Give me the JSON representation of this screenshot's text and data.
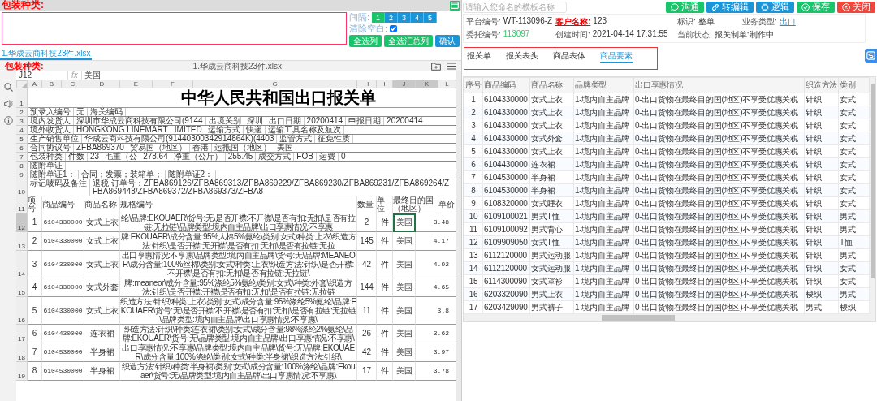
{
  "left": {
    "header_label": "包装种类:",
    "interval_label": "间隔:",
    "interval_buttons": [
      {
        "label": "1",
        "selected": true
      },
      {
        "label": "2",
        "selected": false
      },
      {
        "label": "3",
        "selected": false
      },
      {
        "label": "4",
        "selected": false
      },
      {
        "label": "5",
        "selected": false
      }
    ],
    "clear_blank": {
      "label": "清除空白:",
      "checked": true
    },
    "actions": [
      {
        "label": "全选列",
        "color": "#19c46b"
      },
      {
        "label": "全选汇总列",
        "color": "#19c46b"
      },
      {
        "label": "确认",
        "color": "#1b95d8"
      }
    ],
    "file_tabs": [
      {
        "label": "1.华成云商科技23件.xlsx",
        "selected": true
      }
    ],
    "sheet": {
      "panel_label": "包装种类:",
      "file_name": "1.华成云商科技23件.xlsx",
      "cell_ref": "J12",
      "fx_label": "fx",
      "formula": "美国",
      "columns": [
        {
          "label": "A",
          "selected": false
        },
        {
          "label": "B",
          "selected": false
        },
        {
          "label": "C",
          "selected": false
        },
        {
          "label": "D",
          "selected": false
        },
        {
          "label": "E",
          "selected": false
        },
        {
          "label": "F",
          "selected": false
        },
        {
          "label": "G",
          "selected": false
        },
        {
          "label": "H",
          "selected": false
        },
        {
          "label": "I",
          "selected": false
        },
        {
          "label": "J",
          "selected": true
        },
        {
          "label": "K",
          "selected": true
        },
        {
          "label": "L",
          "selected": false
        }
      ],
      "title_row": "1",
      "title": "中华人民共和国出口报关单",
      "header_rows": [
        {
          "row": "2",
          "cells": [
            "预录入编号",
            "无",
            "海关编码"
          ]
        },
        {
          "row": "3",
          "cells": [
            "境内发货人",
            "深圳市华成云商科技有限公司(9144",
            "出境关别",
            "深圳",
            "出口日期",
            "20200414",
            "申报日期",
            "20200414"
          ]
        },
        {
          "row": "4",
          "cells": [
            "境外收货人",
            "HONGKONG LINEMART LIMITED",
            "运输方式",
            "快递",
            "运输工具名称及航次"
          ]
        },
        {
          "row": "5",
          "cells": [
            "生产销售单位",
            "华成云商科技有限公司(91440300342914864K)(4403",
            "监管方式",
            "征免性质"
          ]
        },
        {
          "row": "6",
          "cells": [
            "合同协议号",
            "ZFBA869370",
            "贸易国（地区）",
            "香港",
            "运抵国（地区）",
            "美国"
          ]
        },
        {
          "row": "7",
          "cells": [
            "包装种类",
            "件数",
            "23",
            "毛重（公",
            "278.64",
            "净重（公斤）",
            "255.45",
            "成交方式",
            "FOB",
            "运费",
            "0"
          ]
        },
        {
          "row": "8",
          "cells": [
            "随附单证"
          ]
        },
        {
          "row": "9",
          "cells": [
            "随附单证1：",
            "合同；发票；装箱单；",
            "随附单证2："
          ]
        },
        {
          "row": "10",
          "cells": [
            "标记唛码及备注",
            "退税 订单号：ZFBA869126/ZFBA869313/ZFBA869229/ZFBA869230/ZFBA869231/ZFBA869264/ZFBA869448/ZFBA869372/ZFBA869373/ZFBA8"
          ]
        }
      ],
      "item_header": {
        "row": "11",
        "no": "项号",
        "code": "商品编号",
        "name": "商品名称",
        "spec": "规格编号",
        "qty": "数量",
        "unit": "单位",
        "country": "最终目的国（地区）",
        "price": "单价"
      },
      "items": [
        {
          "row": "12",
          "no": "1",
          "code": "6104330000",
          "name": "女式上衣",
          "spec": "纶\\品牌:EKOUAER\\货号:无\\是否开襟:不开襟\\是否有扣:无扣\\是否有拉链:无拉链\\品牌类型:境内自主品牌\\出口享惠情况:不享惠",
          "qty": "2",
          "unit": "件",
          "country": "美国",
          "price": "3.48",
          "selected": true
        },
        {
          "row": "13",
          "no": "2",
          "code": "6104330000",
          "name": "女式上衣",
          "spec": "牌:EKOUAER\\成分含量:95%人棉5%氨纶\\类别:女式\\种类:上衣\\织造方法:针织\\是否开襟:无开襟\\是否有扣:无扣\\是否有拉链:无拉",
          "qty": "145",
          "unit": "件",
          "country": "美国",
          "price": "4.17",
          "selected": false
        },
        {
          "row": "14",
          "no": "3",
          "code": "6104330000",
          "name": "女式上衣",
          "spec": "出口享惠情况:不享惠\\品牌类型:境内自主品牌\\货号:无\\品牌:MEANEOR\\成分含量:100%丝棉\\类别:女式\\种类:上衣\\织造方法:针织\\是否开襟:不开襟\\是否有扣:无扣\\是否有拉链:无拉链\\",
          "qty": "42",
          "unit": "件",
          "country": "美国",
          "price": "4.92",
          "selected": false
        },
        {
          "row": "15",
          "no": "4",
          "code": "6104330000",
          "name": "女式外套",
          "spec": "牌:meaneor\\成分含量:95%涤纶5%氨纶\\类别:女式\\种类:外套\\织造方法:针织\\是否开襟:开襟\\是否有扣:无扣\\是否有拉链:无拉链",
          "qty": "144",
          "unit": "件",
          "country": "美国",
          "price": "4.65",
          "selected": false
        },
        {
          "row": "16",
          "no": "5",
          "code": "6104330000",
          "name": "女式上衣",
          "spec": "织造方法:针织\\种类:上衣\\类别:女式\\成分含量:95%涤纶5%氨纶\\品牌:EKOUAER\\货号:无\\是否开襟:不开襟\\是否有扣:无扣\\是否有拉链:无拉链\\品牌类型:境内自主品牌\\出口享惠情况:不享惠\\",
          "qty": "11",
          "unit": "件",
          "country": "美国",
          "price": "3.8",
          "selected": false
        },
        {
          "row": "17",
          "no": "6",
          "code": "6104430000",
          "name": "连衣裙",
          "spec": "织造方法:针织\\种类:连衣裙\\类别:女式\\成分含量:98%涤纶2%氨纶\\品牌:EKOUAER\\货号:无\\品牌类型:境内自主品牌\\出口享惠情况:不享惠\\",
          "qty": "26",
          "unit": "件",
          "country": "美国",
          "price": "3.62",
          "selected": false
        },
        {
          "row": "18",
          "no": "7",
          "code": "6104530000",
          "name": "半身裙",
          "spec": "出口享惠情况:不享惠\\品牌类型:境内自主品牌\\货号:无\\品牌:EKOUAER\\成分含量:100%涤纶\\类别:女式\\种类:半身裙\\织造方法:针织\\",
          "qty": "42",
          "unit": "件",
          "country": "美国",
          "price": "3.97",
          "selected": false
        },
        {
          "row": "19",
          "no": "8",
          "code": "6104530000",
          "name": "半身裙",
          "spec": "织造方法:针织\\种类:半身裙\\类别:女式\\成分含量:100%涤纶\\品牌:Ekouaer\\货号:无\\品牌类型:境内自主品牌\\出口享惠情况:不享惠\\",
          "qty": "17",
          "unit": "件",
          "country": "美国",
          "price": "3.78",
          "selected": false
        }
      ]
    }
  },
  "right": {
    "template_search": {
      "placeholder": "请输入您命名的模板名称"
    },
    "buttons": [
      {
        "label": "沟通",
        "kind": "chat",
        "color": "#19c46b"
      },
      {
        "label": "转编辑",
        "kind": "link",
        "color": "#1b95d8"
      },
      {
        "label": "逻辑",
        "kind": "chip",
        "color": "#1b95d8"
      },
      {
        "label": "保存",
        "kind": "check",
        "color": "#19c46b"
      },
      {
        "label": "关闭",
        "kind": "close",
        "color": "#f0463c"
      }
    ],
    "info_rows": [
      [
        {
          "label": "平台编号:",
          "value": "WT-113096-Z",
          "kind": "plain"
        },
        {
          "label": "客户名称:",
          "value": "123",
          "kind": "alert"
        },
        {
          "label": "标识:",
          "value": "整单",
          "kind": "plain"
        },
        {
          "label": "业务类型:",
          "value": "出口",
          "kind": "link"
        }
      ],
      [
        {
          "label": "委托编号:",
          "value": "113097",
          "kind": "highlight"
        },
        {
          "label": "创建时间:",
          "value": "2021-04-14 17:31:55",
          "kind": "plain"
        },
        {
          "label": "当前状态:",
          "value": "报关制单:制作中",
          "kind": "plain"
        }
      ]
    ],
    "tabs": [
      {
        "label": "报关单",
        "selected": false
      },
      {
        "label": "报关表头",
        "selected": false
      },
      {
        "label": "商品表体",
        "selected": false
      },
      {
        "label": "商品要素",
        "selected": true
      }
    ],
    "table": {
      "columns": [
        "序号",
        "商品编码",
        "商品名称",
        "品牌类型",
        "出口享惠情况",
        "织造方法",
        "类别"
      ],
      "rows": [
        [
          "1",
          "6104330000",
          "女式上衣",
          "1-境内自主品牌",
          "0-出口货物在最终目的国(地区)不享受优惠关税",
          "针织",
          "女式"
        ],
        [
          "2",
          "6104330000",
          "女式上衣",
          "1-境内自主品牌",
          "0-出口货物在最终目的国(地区)不享受优惠关税",
          "针织",
          "女式"
        ],
        [
          "3",
          "6104330000",
          "女式上衣",
          "1-境内自主品牌",
          "0-出口货物在最终目的国(地区)不享受优惠关税",
          "针织",
          "女式"
        ],
        [
          "4",
          "6104330000",
          "女式外套",
          "1-境内自主品牌",
          "0-出口货物在最终目的国(地区)不享受优惠关税",
          "针织",
          "女式"
        ],
        [
          "5",
          "6104330000",
          "女式上衣",
          "1-境内自主品牌",
          "0-出口货物在最终目的国(地区)不享受优惠关税",
          "针织",
          "女式"
        ],
        [
          "6",
          "6104430000",
          "连衣裙",
          "1-境内自主品牌",
          "0-出口货物在最终目的国(地区)不享受优惠关税",
          "针织",
          "女式"
        ],
        [
          "7",
          "6104530000",
          "半身裙",
          "1-境内自主品牌",
          "0-出口货物在最终目的国(地区)不享受优惠关税",
          "针织",
          "女式"
        ],
        [
          "8",
          "6104530000",
          "半身裙",
          "1-境内自主品牌",
          "0-出口货物在最终目的国(地区)不享受优惠关税",
          "针织",
          "女式"
        ],
        [
          "9",
          "6108320000",
          "女式睡衣",
          "1-境内自主品牌",
          "0-出口货物在最终目的国(地区)不享受优惠关税",
          "针织",
          "女式"
        ],
        [
          "10",
          "6109100021",
          "男式T恤",
          "1-境内自主品牌",
          "0-出口货物在最终目的国(地区)不享受优惠关税",
          "针织",
          "男式"
        ],
        [
          "11",
          "6109100092",
          "男式背心",
          "1-境内自主品牌",
          "0-出口货物在最终目的国(地区)不享受优惠关税",
          "针织",
          "男式"
        ],
        [
          "12",
          "6109909050",
          "女式T恤",
          "1-境内自主品牌",
          "0-出口货物在最终目的国(地区)不享受优惠关税",
          "针织",
          "T恤"
        ],
        [
          "13",
          "6112120000",
          "男式运动服",
          "1-境内自主品牌",
          "0-出口货物在最终目的国(地区)不享受优惠关税",
          "针织",
          "男式"
        ],
        [
          "14",
          "6112120000",
          "女式运动服",
          "1-境内自主品牌",
          "0-出口货物在最终目的国(地区)不享受优惠关税",
          "针织",
          "女式"
        ],
        [
          "15",
          "6114300090",
          "女式罩衫",
          "1-境内自主品牌",
          "0-出口货物在最终目的国(地区)不享受优惠关税",
          "针织",
          "女式"
        ],
        [
          "16",
          "6203320090",
          "男式上衣",
          "1-境内自主品牌",
          "0-出口货物在最终目的国(地区)不享受优惠关税",
          "梭织",
          "男式"
        ],
        [
          "17",
          "6203429090",
          "男式裤子",
          "1-境内自主品牌",
          "0-出口货物在最终目的国(地区)不享受优惠关税",
          "男式",
          "梭织"
        ]
      ]
    }
  }
}
